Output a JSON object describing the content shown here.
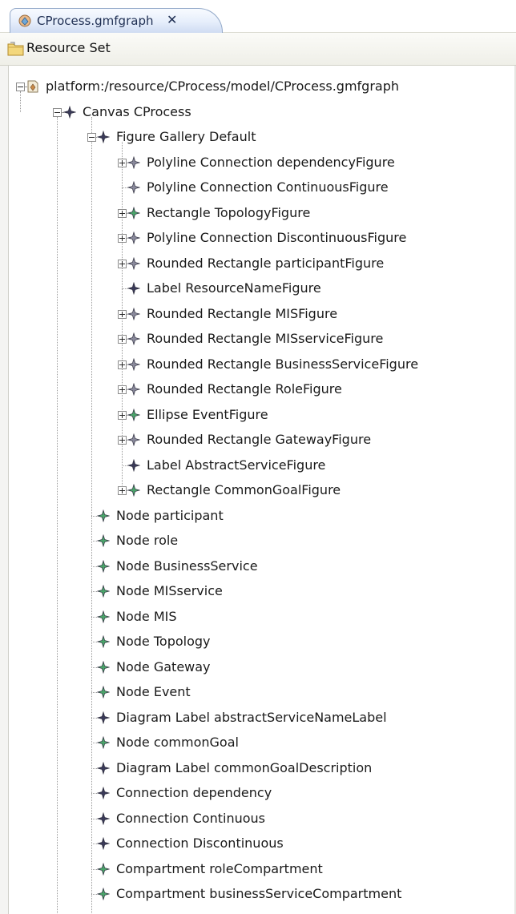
{
  "editor_tab": {
    "title": "CProcess.gmfgraph",
    "close_glyph": "✕",
    "icon": "gmfgraph-file-icon"
  },
  "header": {
    "title": "Resource Set",
    "icon": "resource-set-folder-icon"
  },
  "colors": {
    "diamond_green": "#4aa46a",
    "diamond_gray": "#8a8a9c",
    "diamond_dark": "#3a3a58",
    "tab_border": "#93a9c9"
  },
  "tree": {
    "root": {
      "label": "platform:/resource/CProcess/model/CProcess.gmfgraph",
      "expanded": true
    },
    "canvas": {
      "label": "Canvas CProcess",
      "expanded": true
    },
    "gallery": {
      "label": "Figure Gallery Default",
      "expanded": true
    },
    "gallery_items": [
      {
        "label": "Polyline Connection dependencyFigure",
        "expandable": true,
        "icon": "gray"
      },
      {
        "label": "Polyline Connection ContinuousFigure",
        "expandable": false,
        "icon": "gray"
      },
      {
        "label": "Rectangle TopologyFigure",
        "expandable": true,
        "icon": "green"
      },
      {
        "label": "Polyline Connection DiscontinuousFigure",
        "expandable": true,
        "icon": "gray"
      },
      {
        "label": "Rounded Rectangle participantFigure",
        "expandable": true,
        "icon": "gray"
      },
      {
        "label": "Label ResourceNameFigure",
        "expandable": false,
        "icon": "dark"
      },
      {
        "label": "Rounded Rectangle MISFigure",
        "expandable": true,
        "icon": "gray"
      },
      {
        "label": "Rounded Rectangle MISserviceFigure",
        "expandable": true,
        "icon": "gray"
      },
      {
        "label": "Rounded Rectangle BusinessServiceFigure",
        "expandable": true,
        "icon": "gray"
      },
      {
        "label": "Rounded Rectangle RoleFigure",
        "expandable": true,
        "icon": "gray"
      },
      {
        "label": "Ellipse EventFigure",
        "expandable": true,
        "icon": "green"
      },
      {
        "label": "Rounded Rectangle GatewayFigure",
        "expandable": true,
        "icon": "gray"
      },
      {
        "label": "Label AbstractServiceFigure",
        "expandable": false,
        "icon": "dark"
      },
      {
        "label": "Rectangle CommonGoalFigure",
        "expandable": true,
        "icon": "green"
      }
    ],
    "canvas_items": [
      {
        "label": "Node participant",
        "icon": "green"
      },
      {
        "label": "Node role",
        "icon": "green"
      },
      {
        "label": "Node BusinessService",
        "icon": "green"
      },
      {
        "label": "Node MISservice",
        "icon": "green"
      },
      {
        "label": "Node MIS",
        "icon": "green"
      },
      {
        "label": "Node Topology",
        "icon": "green"
      },
      {
        "label": "Node Gateway",
        "icon": "green"
      },
      {
        "label": "Node Event",
        "icon": "green"
      },
      {
        "label": "Diagram Label abstractServiceNameLabel",
        "icon": "dark"
      },
      {
        "label": "Node commonGoal",
        "icon": "green"
      },
      {
        "label": "Diagram Label commonGoalDescription",
        "icon": "dark"
      },
      {
        "label": "Connection dependency",
        "icon": "dark"
      },
      {
        "label": "Connection Continuous",
        "icon": "dark"
      },
      {
        "label": "Connection Discontinuous",
        "icon": "dark"
      },
      {
        "label": "Compartment roleCompartment",
        "icon": "green"
      },
      {
        "label": "Compartment businessServiceCompartment",
        "icon": "green"
      }
    ]
  }
}
